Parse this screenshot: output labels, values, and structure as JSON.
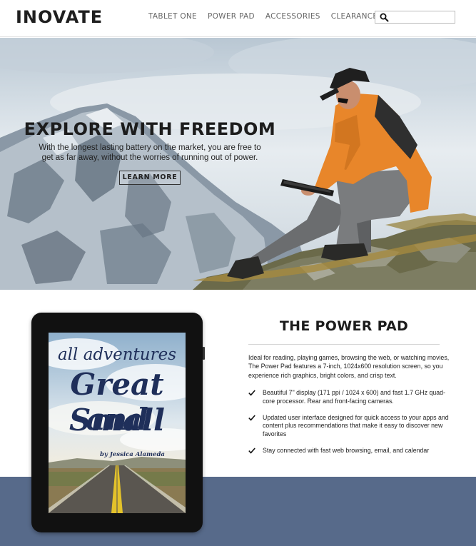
{
  "brand": {
    "logo": "INOVATE"
  },
  "nav": {
    "items": [
      {
        "label": "TABLET ONE",
        "name": "nav-tablet-one"
      },
      {
        "label": "POWER PAD",
        "name": "nav-power-pad"
      },
      {
        "label": "ACCESSORIES",
        "name": "nav-accessories"
      },
      {
        "label": "CLEARANCE",
        "name": "nav-clearance"
      }
    ]
  },
  "search": {
    "value": "",
    "placeholder": "",
    "icon": "search-icon"
  },
  "hero": {
    "title": "EXPLORE WITH FREEDOM",
    "text": "With the longest lasting battery on the market, you are free to get as far away, without the worries of running out of power.",
    "button_label": "LEARN MORE"
  },
  "product": {
    "title": "THE POWER PAD",
    "description": "Ideal for reading, playing games, browsing the web, or watching movies, The Power Pad features a 7-inch, 1024x600 resolution screen, so you experience rich graphics, bright colors, and crisp text.",
    "features": [
      "Beautiful 7\" display (171 ppi / 1024 x 600) and fast 1.7 GHz quad-core processor. Rear and front-facing cameras.",
      "Updated user interface designed for quick access to your apps and content plus recommendations that make it easy to discover new favorites",
      "Stay connected with fast web browsing, email, and calendar"
    ],
    "feature_icon": "checkmark-icon"
  },
  "cover": {
    "line1": "all adventures",
    "line2": "Great and",
    "line3": "Small",
    "author": "by Jessica Alameda"
  },
  "colors": {
    "band": "#576a8a",
    "jacket": "#e8862a",
    "cover_text": "#1f2f5a"
  }
}
